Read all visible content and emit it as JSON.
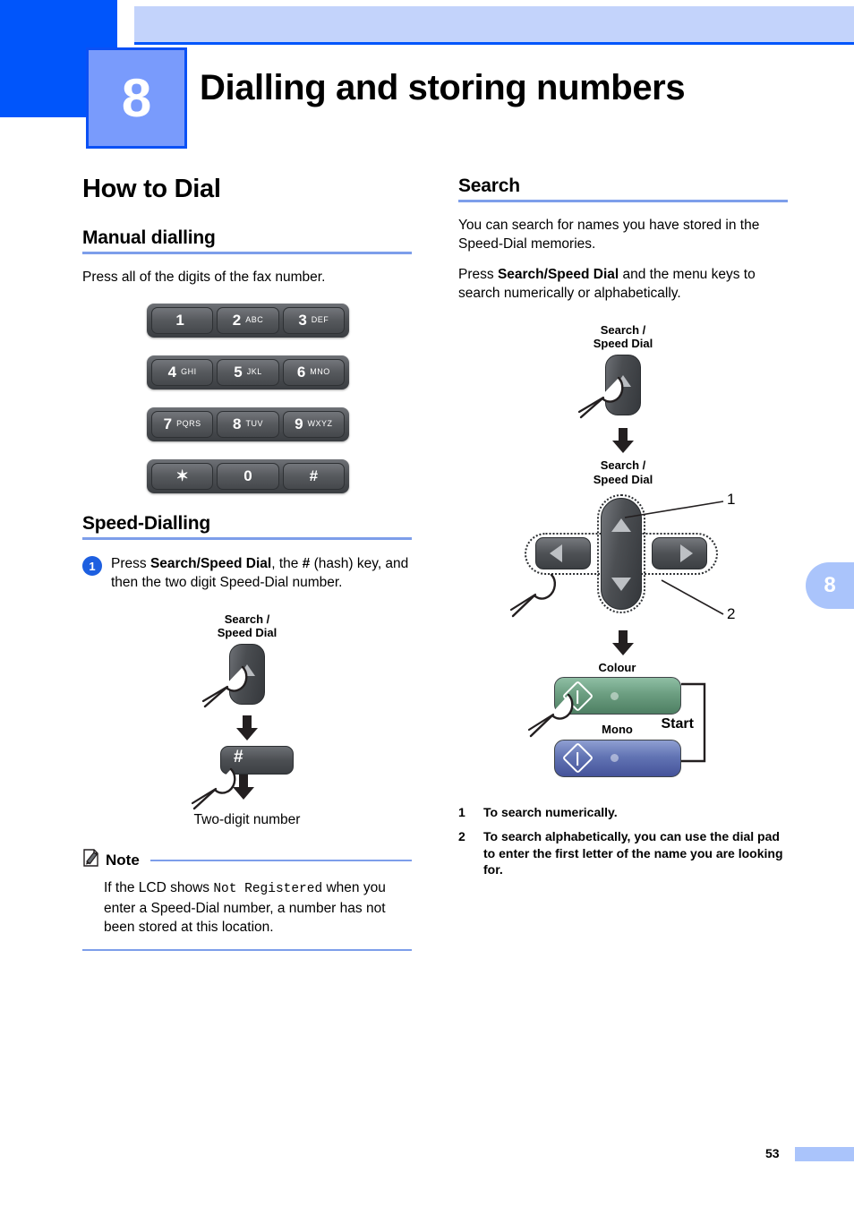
{
  "chapter": {
    "number": "8",
    "title": "Dialling and storing numbers",
    "side_tab": "8"
  },
  "footer": {
    "page_number": "53"
  },
  "left_column": {
    "section_title": "How to Dial",
    "manual": {
      "heading": "Manual dialling",
      "intro": "Press all of the digits of the fax number.",
      "keypad": [
        [
          {
            "digit": "1",
            "letters": ""
          },
          {
            "digit": "2",
            "letters": "ABC"
          },
          {
            "digit": "3",
            "letters": "DEF"
          }
        ],
        [
          {
            "digit": "4",
            "letters": "GHI"
          },
          {
            "digit": "5",
            "letters": "JKL"
          },
          {
            "digit": "6",
            "letters": "MNO"
          }
        ],
        [
          {
            "digit": "7",
            "letters": "PQRS"
          },
          {
            "digit": "8",
            "letters": "TUV"
          },
          {
            "digit": "9",
            "letters": "WXYZ"
          }
        ],
        [
          {
            "digit": "✶",
            "letters": ""
          },
          {
            "digit": "0",
            "letters": ""
          },
          {
            "digit": "#",
            "letters": ""
          }
        ]
      ]
    },
    "speed": {
      "heading": "Speed-Dialling",
      "step1_number": "1",
      "step1_text_a": "Press ",
      "step1_bold_a": "Search/Speed Dial",
      "step1_text_b": ", the ",
      "step1_bold_b": "#",
      "step1_text_c": " (hash) key, and then the two digit Speed-Dial number.",
      "diagram": {
        "key_caption_line1": "Search /",
        "key_caption_line2": "Speed Dial",
        "hash_key_label": "#",
        "result_caption": "Two-digit number"
      }
    },
    "note": {
      "title": "Note",
      "text_a": "If the LCD shows ",
      "lcd_message": "Not Registered",
      "text_b": " when you enter a Speed-Dial number, a number has not been stored at this location."
    }
  },
  "right_column": {
    "heading": "Search",
    "paragraph1": "You can search for names you have stored in the Speed-Dial memories.",
    "paragraph2_a": "Press ",
    "paragraph2_bold": "Search/Speed Dial",
    "paragraph2_b": " and the menu keys to search numerically or alphabetically.",
    "diagram": {
      "step1_caption_line1": "Search /",
      "step1_caption_line2": "Speed Dial",
      "step2_caption_line1": "Search /",
      "step2_caption_line2": "Speed Dial",
      "callout_1": "1",
      "callout_2": "2",
      "colour_label": "Colour",
      "mono_label": "Mono",
      "start_label": "Start"
    },
    "footnotes": [
      {
        "number": "1",
        "text": "To search numerically."
      },
      {
        "number": "2",
        "text": "To search alphabetically, you can use the dial pad to enter the first letter of the name you are looking for."
      }
    ]
  },
  "colors": {
    "brand_blue": "#0055fb",
    "header_light": "#c3d3fb",
    "chapter_box": "#799bfc",
    "rule_blue": "#7d9eea",
    "step_badge": "#1d5fe0",
    "colour_button": "#6c9e81",
    "mono_button": "#6274b4"
  }
}
